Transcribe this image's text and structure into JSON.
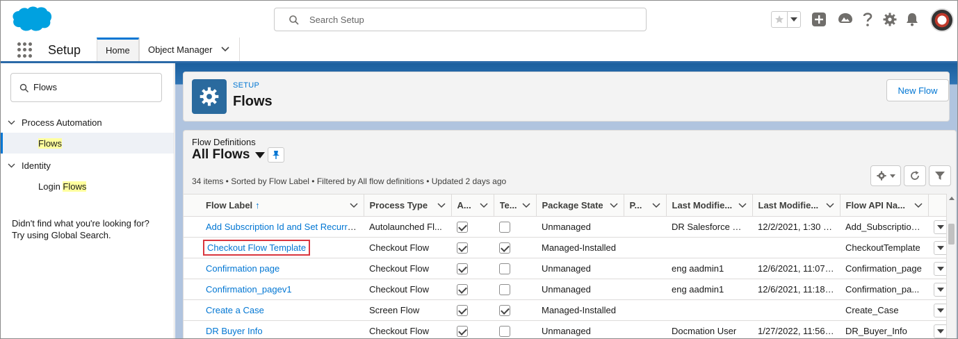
{
  "header": {
    "search_placeholder": "Search Setup"
  },
  "context_bar": {
    "app_name": "Setup",
    "tabs": [
      {
        "label": "Home"
      },
      {
        "label": "Object Manager"
      }
    ]
  },
  "sidebar": {
    "quickfind_value": "Flows",
    "tree": {
      "process_automation": "Process Automation",
      "flows": "Flows",
      "identity": "Identity",
      "login_prefix": "Login ",
      "login_flows": "Flows"
    },
    "not_found_line1": "Didn't find what you're looking for?",
    "not_found_line2": "Try using Global Search."
  },
  "page_header": {
    "crumb": "SETUP",
    "title": "Flows",
    "new_flow_label": "New Flow"
  },
  "list_view": {
    "object_label": "Flow Definitions",
    "name": "All Flows",
    "meta": "34 items • Sorted by Flow Label • Filtered by All flow definitions • Updated 2 days ago",
    "columns": [
      "Flow Label",
      "Process Type",
      "A...",
      "Te...",
      "Package State",
      "P...",
      "Last Modifie...",
      "Last Modifie...",
      "Flow API Na..."
    ],
    "sort_indicator": "↑",
    "rows": [
      {
        "label": "Add Subscription Id and Set Recurrin...",
        "process_type": "Autolaunched Fl...",
        "active": true,
        "template": false,
        "package_state": "Unmanaged",
        "p": "",
        "modified_by": "DR Salesforce User",
        "modified_date": "12/2/2021, 1:30 P...",
        "api_name": "Add_Subscription...",
        "boxed": false
      },
      {
        "label": "Checkout Flow Template",
        "process_type": "Checkout Flow",
        "active": true,
        "template": true,
        "package_state": "Managed-Installed",
        "p": "",
        "modified_by": "",
        "modified_date": "",
        "api_name": "CheckoutTemplate",
        "boxed": true
      },
      {
        "label": "Confirmation page",
        "process_type": "Checkout Flow",
        "active": true,
        "template": false,
        "package_state": "Unmanaged",
        "p": "",
        "modified_by": "eng aadmin1",
        "modified_date": "12/6/2021, 11:07 ...",
        "api_name": "Confirmation_page",
        "boxed": false
      },
      {
        "label": "Confirmation_pagev1",
        "process_type": "Checkout Flow",
        "active": true,
        "template": false,
        "package_state": "Unmanaged",
        "p": "",
        "modified_by": "eng aadmin1",
        "modified_date": "12/6/2021, 11:18 ...",
        "api_name": "Confirmation_pa...",
        "boxed": false
      },
      {
        "label": "Create a Case",
        "process_type": "Screen Flow",
        "active": true,
        "template": true,
        "package_state": "Managed-Installed",
        "p": "",
        "modified_by": "",
        "modified_date": "",
        "api_name": "Create_Case",
        "boxed": false
      },
      {
        "label": "DR Buyer Info",
        "process_type": "Checkout Flow",
        "active": true,
        "template": false,
        "package_state": "Unmanaged",
        "p": "",
        "modified_by": "Docmation User",
        "modified_date": "1/27/2022, 11:56 ...",
        "api_name": "DR_Buyer_Info",
        "boxed": false
      }
    ]
  },
  "colors": {
    "brand_blue": "#0176d3",
    "salesforce_cloud": "#00a1e0",
    "header_badge": "#2a6a9e",
    "highlight": "#ffff9e",
    "callout_red": "#d9363e"
  },
  "icons": [
    "salesforce-logo",
    "search-icon",
    "favorite-star-icon",
    "add-icon",
    "trailhead-icon",
    "help-icon",
    "gear-icon",
    "bell-icon",
    "app-launcher-icon",
    "chevron-down-icon",
    "pin-icon",
    "refresh-icon",
    "filter-icon"
  ]
}
